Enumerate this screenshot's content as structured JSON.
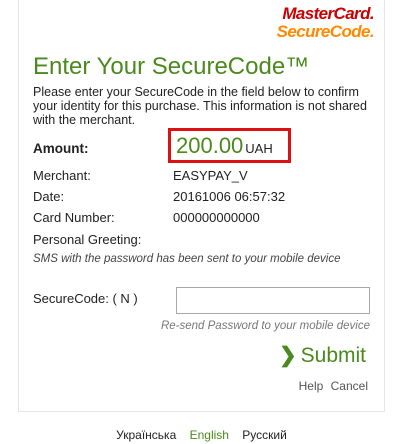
{
  "logo": {
    "brand_top": "MasterCard.",
    "brand_bottom": "SecureCode."
  },
  "title": "Enter Your SecureCode™",
  "intro": "Please enter your SecureCode in the field below to confirm your identity for this purchase. This information is not shared with the merchant.",
  "fields": {
    "amount_label": "Amount:",
    "amount_value": "200.00",
    "amount_currency": "UAH",
    "merchant_label": "Merchant:",
    "merchant_value": "EASYPAY_V",
    "date_label": "Date:",
    "date_value": "20161006 06:57:32",
    "card_label": "Card Number:",
    "card_value": "000000000000",
    "greeting_label": "Personal Greeting:"
  },
  "sms_notice": "SMS with the password has been sent to your mobile device",
  "securecode": {
    "label": "SecureCode:  ( N )",
    "value": ""
  },
  "resend_link": "Re-send Password to your mobile device",
  "submit_label": "Submit",
  "help_label": "Help",
  "cancel_label": "Cancel",
  "languages": [
    "Українська",
    "English",
    "Русский"
  ],
  "active_language": "English",
  "colors": {
    "accent": "#4a8a1c",
    "highlight_box": "#dd1111",
    "brand_red": "#cc0000",
    "brand_orange": "#ff8a00"
  }
}
